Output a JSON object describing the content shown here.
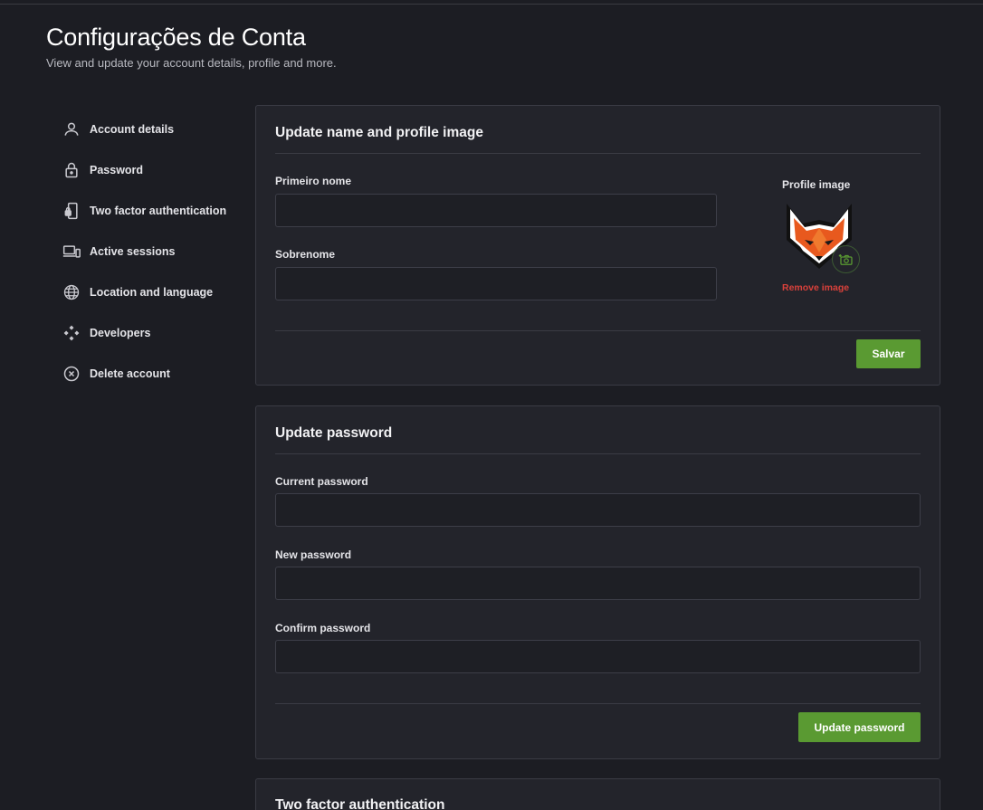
{
  "page": {
    "title": "Configurações de Conta",
    "subtitle": "View and update your account details, profile and more."
  },
  "sidebar": {
    "items": [
      {
        "label": "Account details",
        "icon": "user-icon"
      },
      {
        "label": "Password",
        "icon": "lock-icon"
      },
      {
        "label": "Two factor authentication",
        "icon": "phone-lock-icon"
      },
      {
        "label": "Active sessions",
        "icon": "devices-icon"
      },
      {
        "label": "Location and language",
        "icon": "globe-icon"
      },
      {
        "label": "Developers",
        "icon": "developers-icon"
      },
      {
        "label": "Delete account",
        "icon": "close-circle-icon"
      }
    ]
  },
  "profile_card": {
    "title": "Update name and profile image",
    "first_name_label": "Primeiro nome",
    "first_name_value": "",
    "last_name_label": "Sobrenome",
    "last_name_value": "",
    "profile_image_label": "Profile image",
    "avatar_icon": "fox-avatar",
    "camera_icon": "camera-add-icon",
    "remove_image_label": "Remove image",
    "save_label": "Salvar"
  },
  "password_card": {
    "title": "Update password",
    "current_label": "Current password",
    "current_value": "",
    "new_label": "New password",
    "new_value": "",
    "confirm_label": "Confirm password",
    "confirm_value": "",
    "submit_label": "Update password"
  },
  "twofa_card": {
    "title": "Two factor authentication"
  },
  "colors": {
    "background": "#1c1d23",
    "card": "#23242b",
    "accent": "#5a9a32",
    "danger": "#d9413b"
  }
}
